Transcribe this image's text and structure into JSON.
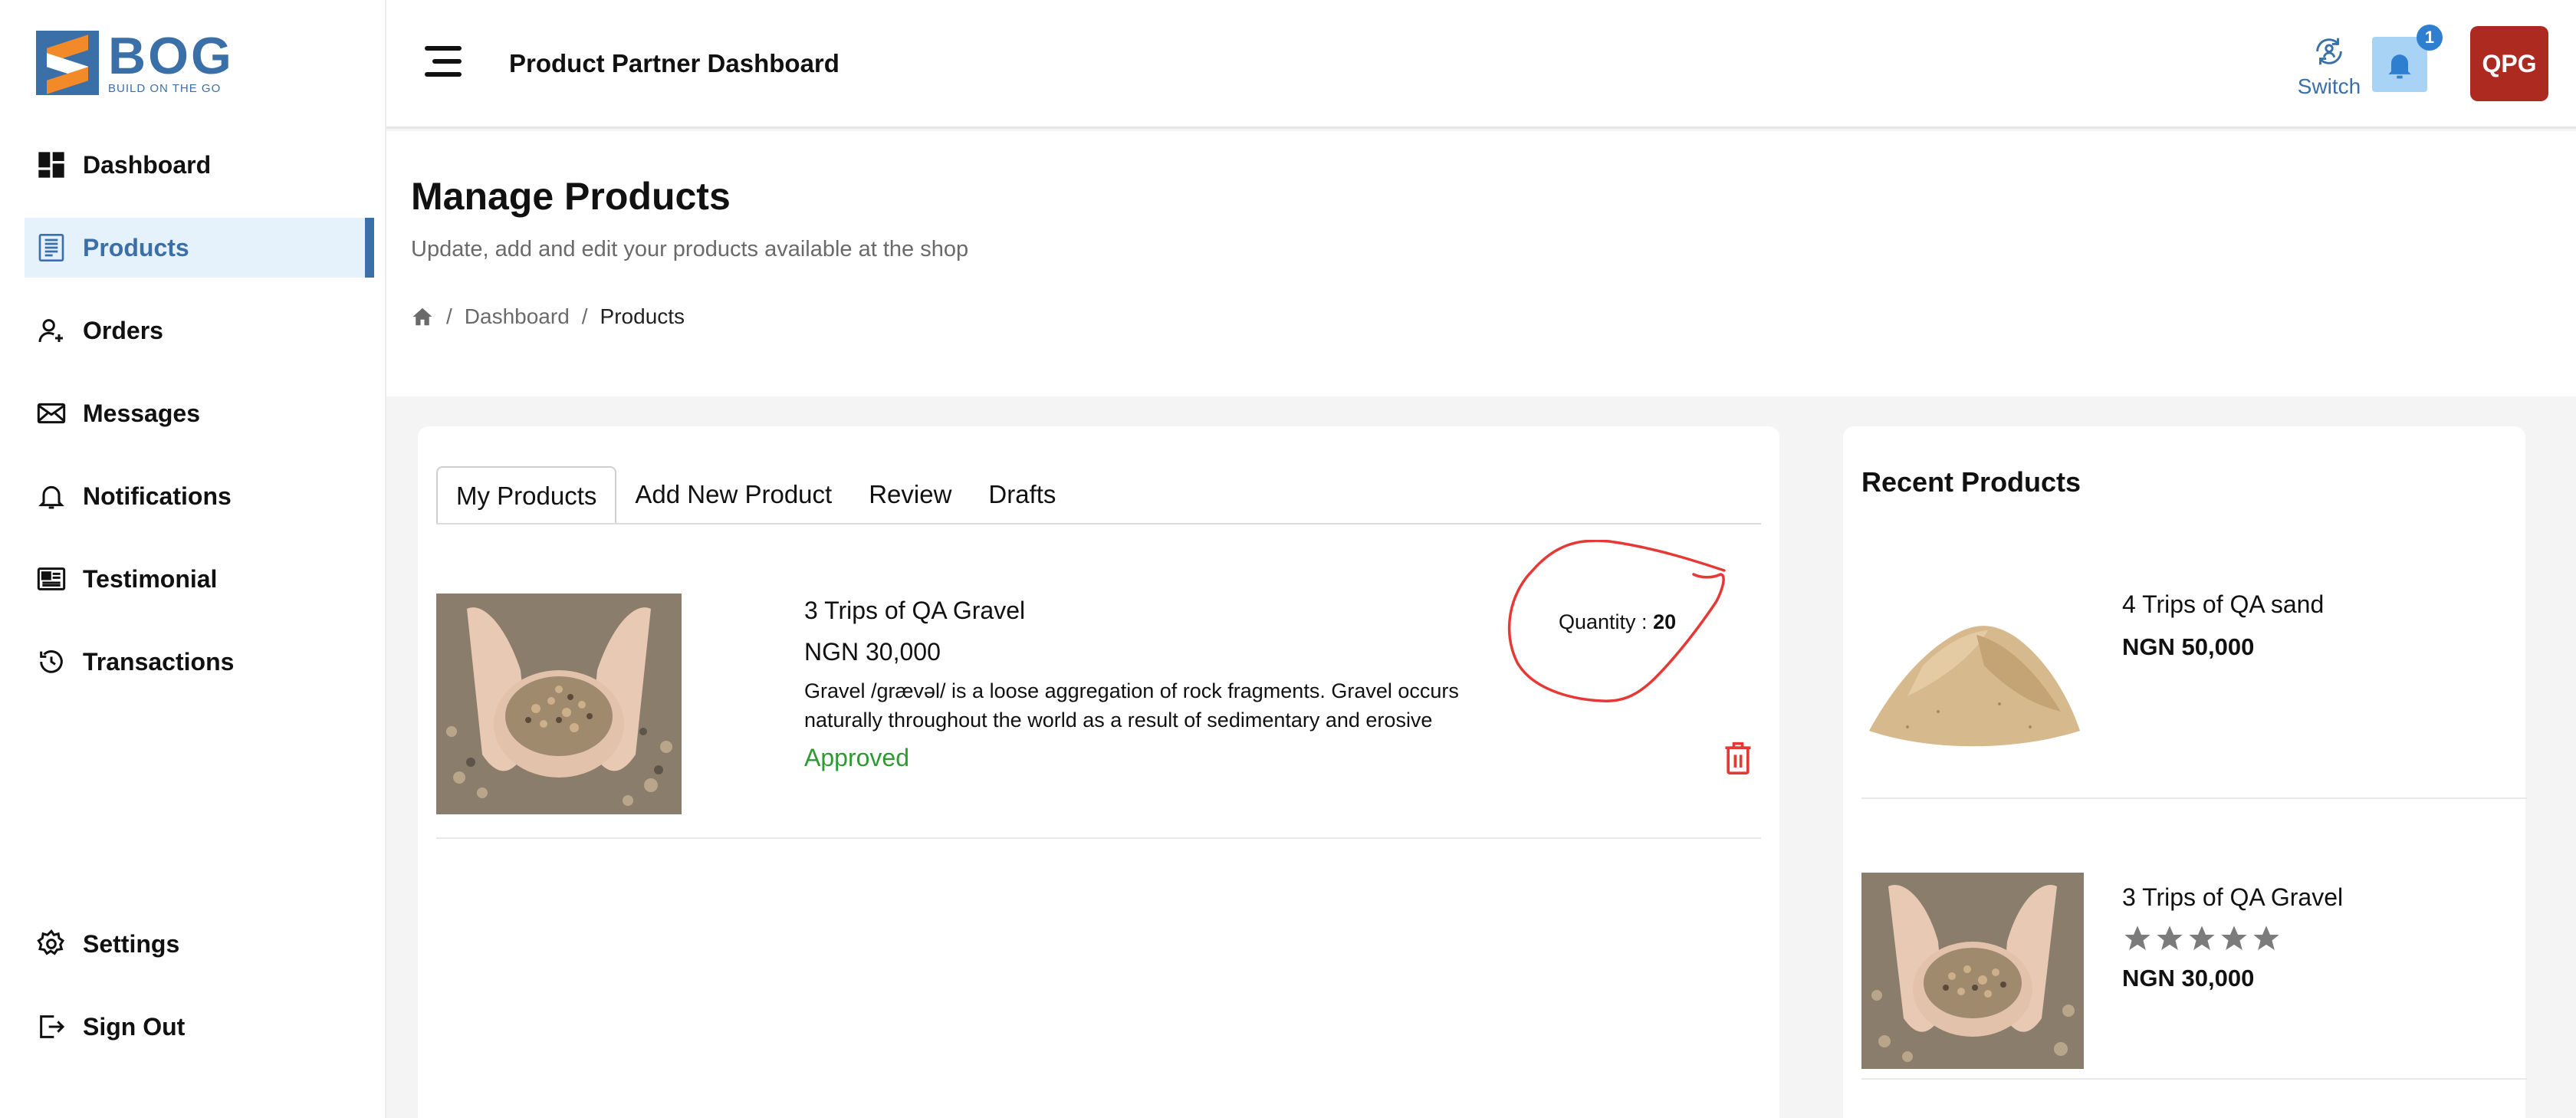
{
  "brand": {
    "name": "BOG",
    "tagline": "BUILD ON THE GO"
  },
  "sidebar": {
    "items": [
      {
        "label": "Dashboard",
        "icon": "dashboard-icon"
      },
      {
        "label": "Products",
        "icon": "products-icon",
        "active": true
      },
      {
        "label": "Orders",
        "icon": "orders-icon"
      },
      {
        "label": "Messages",
        "icon": "envelope-icon"
      },
      {
        "label": "Notifications",
        "icon": "bell-icon"
      },
      {
        "label": "Testimonial",
        "icon": "newspaper-icon"
      },
      {
        "label": "Transactions",
        "icon": "history-icon"
      }
    ],
    "bottom": [
      {
        "label": "Settings",
        "icon": "gear-icon"
      },
      {
        "label": "Sign Out",
        "icon": "sign-out-icon"
      }
    ]
  },
  "header": {
    "title": "Product Partner Dashboard",
    "switch_label": "Switch",
    "notification_count": "1",
    "avatar_initials": "QPG"
  },
  "page": {
    "title": "Manage Products",
    "subtitle": "Update, add and edit your products available at the shop",
    "breadcrumb": {
      "parent": "Dashboard",
      "separator": "/",
      "current": "Products"
    }
  },
  "tabs": [
    {
      "label": "My Products",
      "active": true
    },
    {
      "label": "Add New Product"
    },
    {
      "label": "Review"
    },
    {
      "label": "Drafts"
    }
  ],
  "products": [
    {
      "name": "3 Trips of QA Gravel",
      "price": "NGN 30,000",
      "description": "Gravel /ɡrævəl/ is a loose aggregation of rock fragments. Gravel occurs naturally throughout the world as a result of sedimentary and erosive",
      "status": "Approved",
      "quantity_label": "Quantity : ",
      "quantity": "20"
    }
  ],
  "recent": {
    "title": "Recent Products",
    "items": [
      {
        "name": "4 Trips of QA sand",
        "price": "NGN 50,000"
      },
      {
        "name": "3 Trips of QA Gravel",
        "price": "NGN 30,000",
        "rating": 0,
        "rating_max": 5
      }
    ]
  },
  "colors": {
    "brand_blue": "#3a6fa8",
    "brand_orange": "#f28a2a",
    "approved_green": "#2e9a32",
    "avatar_red": "#ad2a21",
    "annotation_red": "#e53935"
  }
}
